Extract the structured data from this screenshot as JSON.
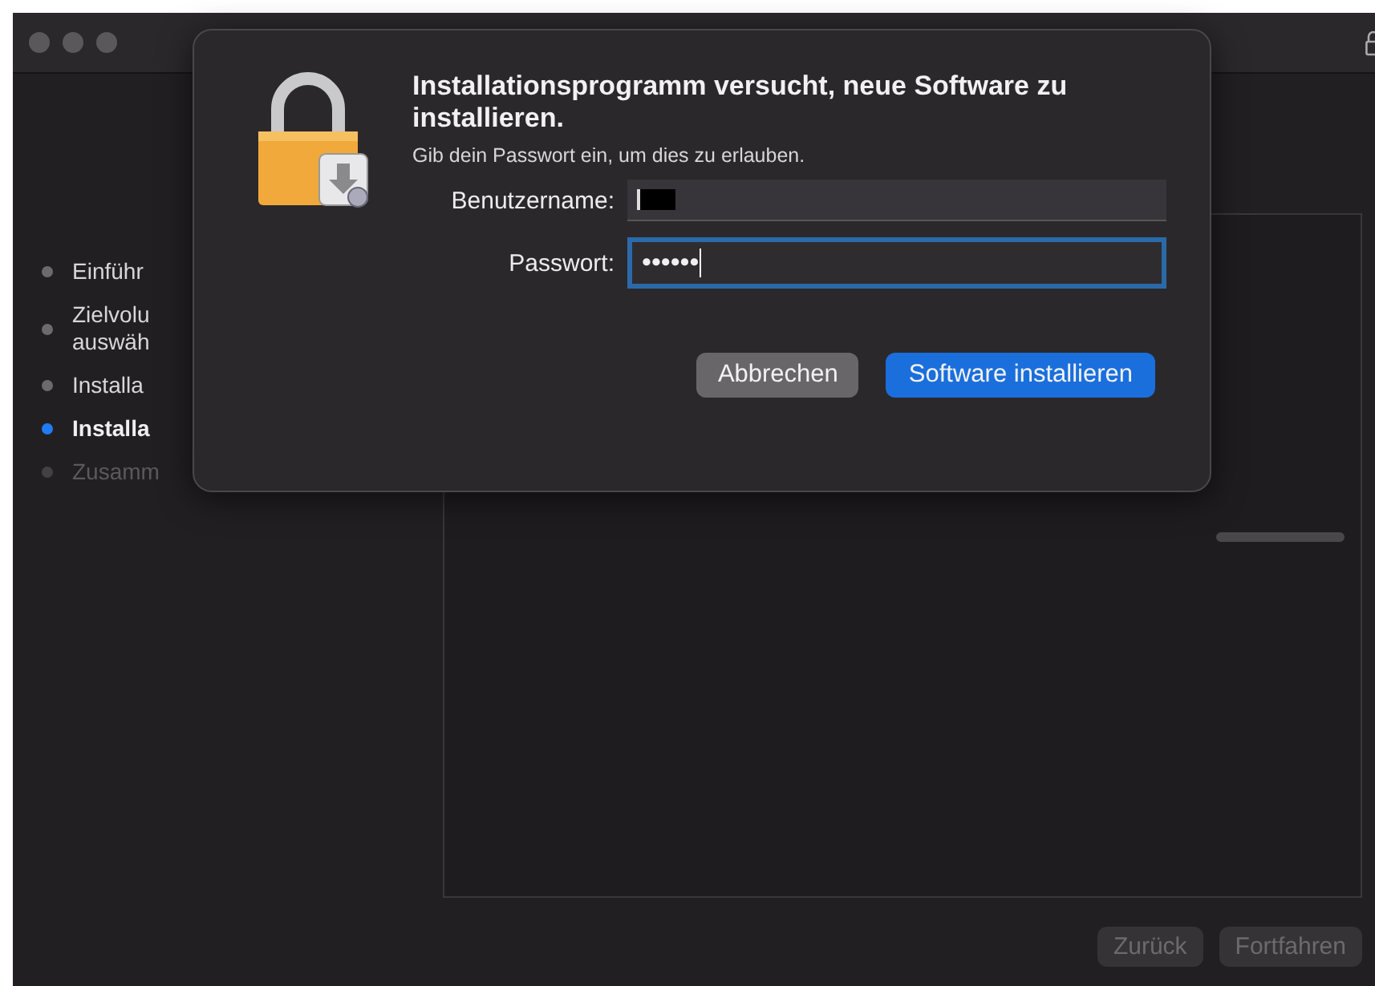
{
  "sidebar": {
    "items": [
      {
        "label": "Einführ",
        "kind": "done"
      },
      {
        "label": "Zielvolu\nauswäh",
        "kind": "done"
      },
      {
        "label": "Installa",
        "kind": "done"
      },
      {
        "label": "Installa",
        "kind": "current"
      },
      {
        "label": "Zusamm",
        "kind": "pending"
      }
    ]
  },
  "progress": {
    "level": 0
  },
  "dialog": {
    "title": "Installationsprogramm versucht, neue Software zu installieren.",
    "message": "Gib dein Passwort ein, um dies zu erlauben.",
    "fields": [
      {
        "label": "Benutzername:",
        "kind": "redacted",
        "focused": false
      },
      {
        "label": "Passwort:",
        "kind": "secret",
        "value": "••••••",
        "focused": true
      }
    ],
    "buttons": [
      {
        "label": "Abbrechen",
        "default": false
      },
      {
        "label": "Software installieren",
        "default": true
      }
    ]
  },
  "footer": {
    "buttons": [
      {
        "label": "Zurück",
        "disabled": true
      },
      {
        "label": "Fortfahren",
        "disabled": true
      }
    ]
  }
}
